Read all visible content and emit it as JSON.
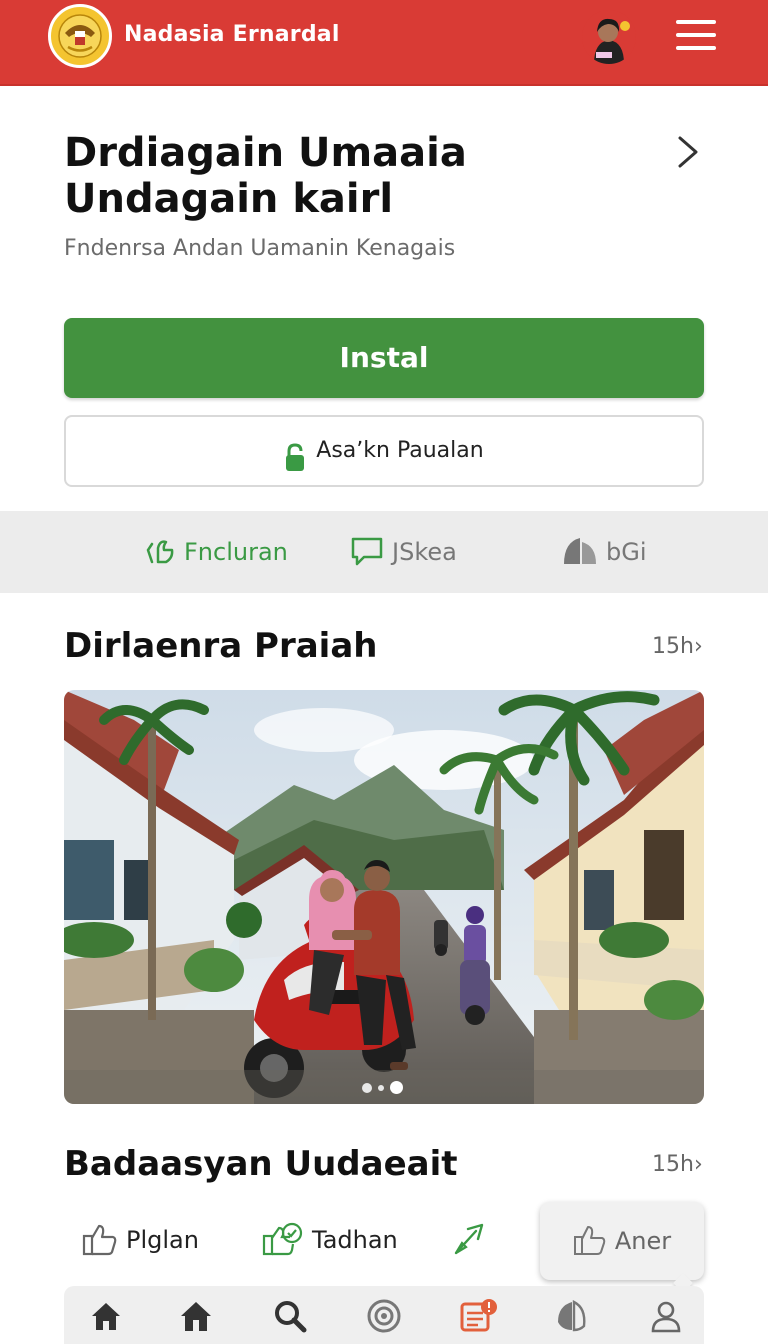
{
  "app_bar": {
    "title": "Nadasia Ernardal",
    "background": "#d93b35",
    "logo_icon": "emblem-logo",
    "avatar_icon": "user-avatar",
    "menu_icon": "hamburger-menu-icon"
  },
  "hero": {
    "title": "Drdiagain Umaaia Undagain kairl",
    "subtitle": "Fndenrsa Andan Uamanin Kenagais",
    "chevron_icon": "chevron-right-icon"
  },
  "buttons": {
    "install_label": "Instal",
    "install_color": "#43923f",
    "secondary_label": "Asaʼkn Paualan",
    "secondary_icon": "lock-icon"
  },
  "action_strip": [
    {
      "label": "Fncluran",
      "icon": "sparkle-icon",
      "color": "#3a9a44"
    },
    {
      "label": "JSkea",
      "icon": "chat-bubble-icon",
      "color": "#777777"
    },
    {
      "label": "bGi",
      "icon": "leaf-icon",
      "color": "#777777"
    }
  ],
  "sections": [
    {
      "title": "Dirlaenra Praiah",
      "meta": "15h›"
    },
    {
      "title": "Badaasyan Uudaeait",
      "meta": "15h›"
    }
  ],
  "carousel": {
    "slide_count": 3,
    "active_slide": 2
  },
  "reactions": [
    {
      "label": "Plglan",
      "icon": "thumbs-up-icon"
    },
    {
      "label": "Tadhan",
      "icon": "comment-heart-icon"
    },
    {
      "label": "",
      "icon": "share-arrow-icon"
    },
    {
      "label": "Aner",
      "icon": "thumbs-up-outline-icon"
    }
  ],
  "bottom_nav": [
    {
      "icon": "home-icon"
    },
    {
      "icon": "home-alt-icon"
    },
    {
      "icon": "search-icon"
    },
    {
      "icon": "target-icon"
    },
    {
      "icon": "notification-badge-icon"
    },
    {
      "icon": "leaf-icon"
    },
    {
      "icon": "profile-icon"
    }
  ]
}
